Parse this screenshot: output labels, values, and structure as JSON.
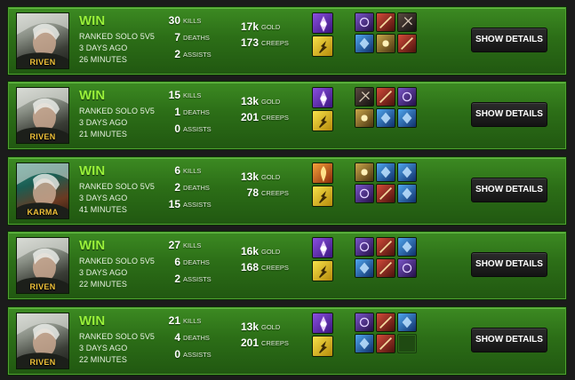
{
  "match_list": {
    "stat_labels": {
      "kills": "KILLS",
      "deaths": "DEATHS",
      "assists": "ASSISTS",
      "gold": "GOLD",
      "creeps": "CREEPS"
    },
    "details_button_label": "SHOW DETAILS",
    "matches": [
      {
        "champion": "RIVEN",
        "result": "WIN",
        "queue": "RANKED SOLO 5V5",
        "time_ago": "3 DAYS AGO",
        "duration": "26 MINUTES",
        "kills": "30",
        "deaths": "7",
        "assists": "2",
        "gold": "17k",
        "creeps": "173",
        "spells": [
          "spell-icon-purple",
          "flash-icon"
        ],
        "items": [
          "item-icon-purple",
          "item-icon-red",
          "item-icon-dark",
          "item-icon-blue",
          "item-icon-gold",
          "item-icon-red"
        ]
      },
      {
        "champion": "RIVEN",
        "result": "WIN",
        "queue": "RANKED SOLO 5V5",
        "time_ago": "3 DAYS AGO",
        "duration": "21 MINUTES",
        "kills": "15",
        "deaths": "1",
        "assists": "0",
        "gold": "13k",
        "creeps": "201",
        "spells": [
          "spell-icon-purple",
          "flash-icon"
        ],
        "items": [
          "item-icon-dark",
          "item-icon-red",
          "item-icon-purple",
          "item-icon-gold",
          "item-icon-blue",
          "item-icon-blue"
        ]
      },
      {
        "champion": "KARMA",
        "result": "WIN",
        "queue": "RANKED SOLO 5V5",
        "time_ago": "3 DAYS AGO",
        "duration": "41 MINUTES",
        "kills": "6",
        "deaths": "2",
        "assists": "15",
        "gold": "13k",
        "creeps": "78",
        "spells": [
          "spell-icon-orange",
          "flash-icon"
        ],
        "items": [
          "item-icon-gold",
          "item-icon-blue",
          "item-icon-blue",
          "item-icon-purple",
          "item-icon-red",
          "item-icon-blue"
        ]
      },
      {
        "champion": "RIVEN",
        "result": "WIN",
        "queue": "RANKED SOLO 5V5",
        "time_ago": "3 DAYS AGO",
        "duration": "22 MINUTES",
        "kills": "27",
        "deaths": "6",
        "assists": "2",
        "gold": "16k",
        "creeps": "168",
        "spells": [
          "spell-icon-purple",
          "flash-icon"
        ],
        "items": [
          "item-icon-purple",
          "item-icon-red",
          "item-icon-blue",
          "item-icon-blue",
          "item-icon-red",
          "item-icon-purple"
        ]
      },
      {
        "champion": "RIVEN",
        "result": "WIN",
        "queue": "RANKED SOLO 5V5",
        "time_ago": "3 DAYS AGO",
        "duration": "22 MINUTES",
        "kills": "21",
        "deaths": "4",
        "assists": "0",
        "gold": "13k",
        "creeps": "201",
        "spells": [
          "spell-icon-purple",
          "flash-icon"
        ],
        "items": [
          "item-icon-purple",
          "item-icon-red",
          "item-icon-blue",
          "item-icon-blue",
          "item-icon-red",
          "empty-slot"
        ]
      }
    ]
  },
  "colors": {
    "row_green": "#2c6e17",
    "win_green": "#9af23a",
    "champion_label": "#f0c23a",
    "button_bg": "#1c1c1c"
  }
}
